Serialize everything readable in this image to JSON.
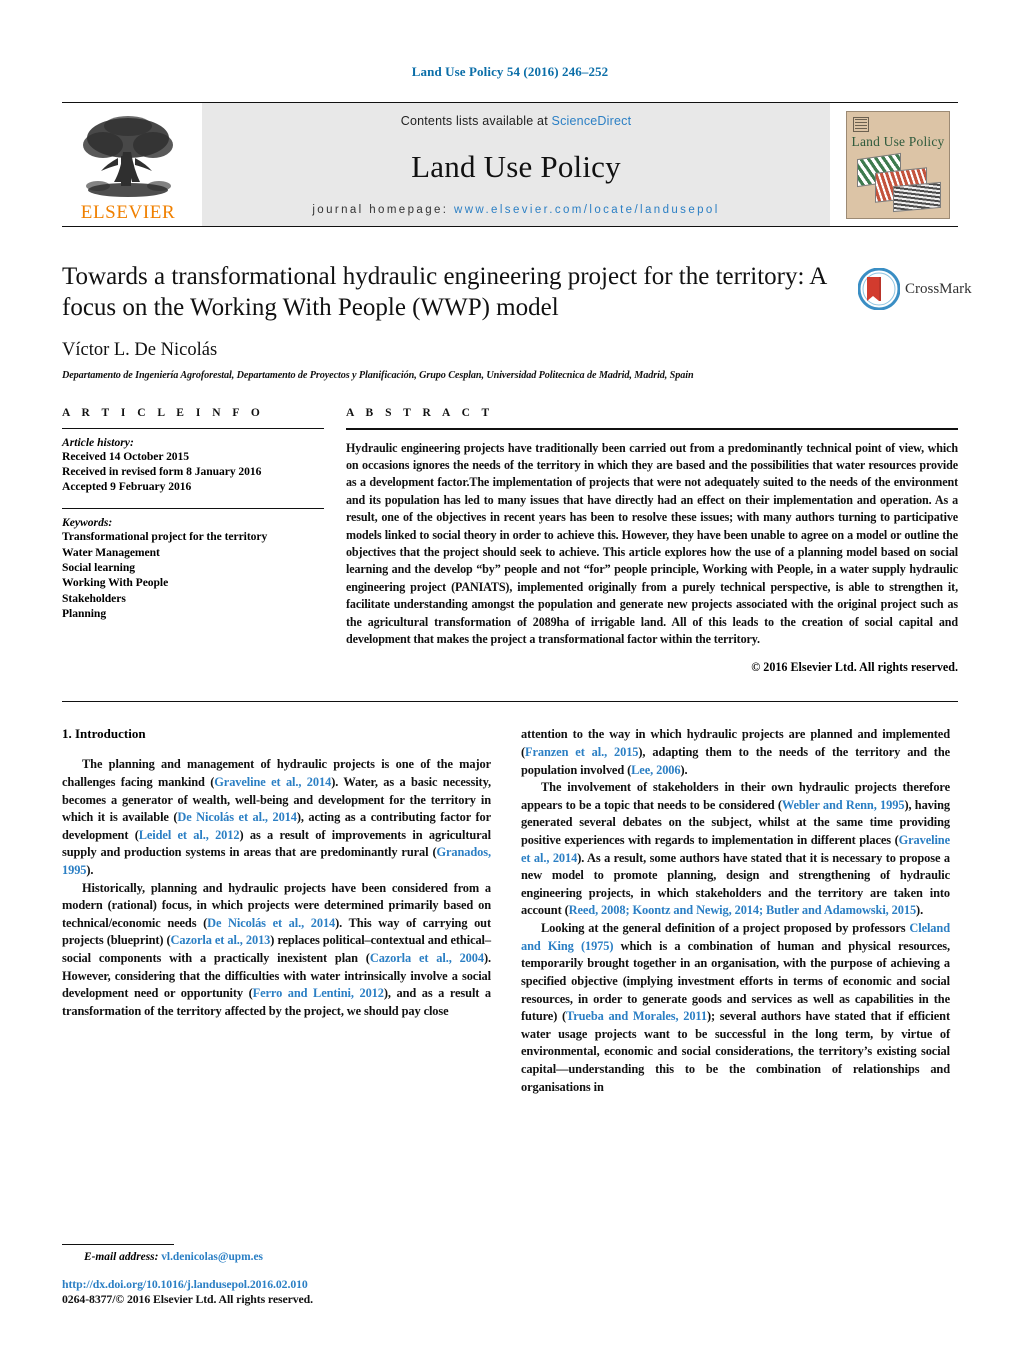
{
  "running_head": "Land Use Policy 54 (2016) 246–252",
  "journal_header": {
    "publisher_name": "ELSEVIER",
    "contents_prefix": "Contents lists available at ",
    "contents_link": "ScienceDirect",
    "journal_title": "Land Use Policy",
    "homepage_prefix": "journal homepage: ",
    "homepage_url": "www.elsevier.com/locate/landusepol",
    "cover_title": "Land Use Policy",
    "link_color": "#2b7fc4"
  },
  "article": {
    "title": "Towards a transformational hydraulic engineering project for the territory: A focus on the Working With People (WWP) model",
    "author": "Víctor L. De Nicolás",
    "affiliation": "Departamento de Ingeniería Agroforestal, Departamento de Proyectos y Planificación, Grupo Cesplan, Universidad Politecnica de Madrid, Madrid, Spain",
    "crossmark_label": "CrossMark"
  },
  "article_info": {
    "heading": "A R T I C L E   I N F O",
    "history_label": "Article history:",
    "history": [
      "Received 14 October 2015",
      "Received in revised form 8 January 2016",
      "Accepted 9 February 2016"
    ],
    "keywords_label": "Keywords:",
    "keywords": [
      "Transformational project for the territory",
      "Water Management",
      "Social learning",
      "Working With People",
      "Stakeholders",
      "Planning"
    ]
  },
  "abstract": {
    "heading": "A B S T R A C T",
    "text": " Hydraulic engineering projects have traditionally been carried out from a predominantly technical point of view, which on occasions ignores the needs of the territory in which they are based and the possibilities that water resources provide as a development factor.The implementation of projects that were not adequately suited to the needs of the environment and its population has led to many issues that have directly had an effect on their implementation and operation. As a result, one of the objectives in recent years has been to resolve these issues; with many authors turning to participative models linked to social theory in order to achieve this. However, they have been unable to agree on a model or outline the objectives that the project should seek to achieve. This article explores how the use of a planning model based on social learning and the develop “by” people and not “for” people principle, Working with People, in a water supply hydraulic engineering project (PANIATS), implemented originally from a purely technical perspective, is able to strengthen it, facilitate understanding amongst the population and generate new projects associated with the original project such as the agricultural transformation of 2089ha of irrigable land. All of this leads to the creation of social capital and development that makes the project a transformational factor within the territory.",
    "copyright": "© 2016 Elsevier Ltd. All rights reserved."
  },
  "body": {
    "section_number_title": "1.  Introduction",
    "left_paragraphs": [
      [
        {
          "t": "The planning and management of hydraulic projects is one of the major challenges facing mankind ("
        },
        {
          "t": "Graveline et al., 2014",
          "c": true
        },
        {
          "t": "). Water, as a basic necessity, becomes a generator of wealth, well-being and development for the territory in which it is available ("
        },
        {
          "t": "De Nicolás et al., 2014",
          "c": true
        },
        {
          "t": "), acting as a contributing factor for development ("
        },
        {
          "t": "Leidel et al., 2012",
          "c": true
        },
        {
          "t": ") as a result of improvements in agricultural supply and production systems in areas that are predominantly rural ("
        },
        {
          "t": "Granados, 1995",
          "c": true
        },
        {
          "t": ")."
        }
      ],
      [
        {
          "t": "Historically, planning and hydraulic projects have been considered from a modern (rational) focus, in which projects were determined primarily based on technical/economic needs ("
        },
        {
          "t": "De Nicolás et al., 2014",
          "c": true
        },
        {
          "t": "). This way of carrying out projects (blueprint) ("
        },
        {
          "t": "Cazorla et al., 2013",
          "c": true
        },
        {
          "t": ") replaces political–contextual and ethical–social components with a practically inexistent plan ("
        },
        {
          "t": "Cazorla et al., 2004",
          "c": true
        },
        {
          "t": "). However, considering that the difficulties with water intrinsically involve a social development need or opportunity ("
        },
        {
          "t": "Ferro and Lentini, 2012",
          "c": true
        },
        {
          "t": "), and as a result a transformation of the territory affected by the project, we should pay close"
        }
      ]
    ],
    "right_paragraphs": [
      [
        {
          "t": "attention to the way in which hydraulic projects are planned and implemented ("
        },
        {
          "t": "Franzen et al., 2015",
          "c": true
        },
        {
          "t": "), adapting them to the needs of the territory and the population involved ("
        },
        {
          "t": "Lee, 2006",
          "c": true
        },
        {
          "t": ")."
        }
      ],
      [
        {
          "t": "The involvement of stakeholders in their own hydraulic projects therefore appears to be a topic that needs to be considered ("
        },
        {
          "t": "Webler and Renn, 1995",
          "c": true
        },
        {
          "t": "), having generated several debates on the subject, whilst at the same time providing positive experiences with regards to implementation in different places ("
        },
        {
          "t": "Graveline et al., 2014",
          "c": true
        },
        {
          "t": "). As a result, some authors have stated that it is necessary to propose a new model to promote planning, design and strengthening of hydraulic engineering projects, in which stakeholders and the territory are taken into account ("
        },
        {
          "t": "Reed, 2008; Koontz and Newig, 2014; Butler and Adamowski, 2015",
          "c": true
        },
        {
          "t": ")."
        }
      ],
      [
        {
          "t": "Looking at the general definition of a project proposed by professors "
        },
        {
          "t": "Cleland and King (1975)",
          "c": true
        },
        {
          "t": " which is a combination of human and physical resources, temporarily brought together in an organisation, with the purpose of achieving a specified objective (implying investment efforts in terms of economic and social resources, in order to generate goods and services as well as capabilities in the future) ("
        },
        {
          "t": "Trueba and Morales, 2011",
          "c": true
        },
        {
          "t": "); several authors have stated that if efficient water usage projects want to be successful in the long term, by virtue of environmental, economic and social considerations, the territory’s existing social capital—understanding this to be the combination of relationships and organisations in"
        }
      ]
    ]
  },
  "footnote": {
    "label": "E-mail address:",
    "email": "vl.denicolas@upm.es"
  },
  "footer": {
    "doi": "http://dx.doi.org/10.1016/j.landusepol.2016.02.010",
    "issn_line": "0264-8377/© 2016 Elsevier Ltd. All rights reserved."
  }
}
